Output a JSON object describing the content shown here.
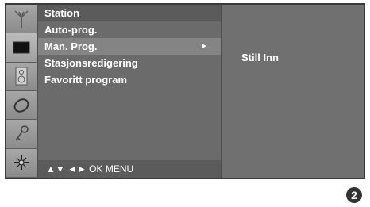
{
  "icons": [
    "antenna-icon",
    "picture-icon",
    "speaker-icon",
    "disc-icon",
    "key-icon",
    "settings-icon"
  ],
  "menu": {
    "title": "Station",
    "items": [
      {
        "label": "Auto-prog."
      },
      {
        "label": "Man. Prog.",
        "arrow": "►"
      },
      {
        "label": "Stasjonsredigering"
      },
      {
        "label": "Favoritt program"
      }
    ],
    "footer": "▲▼  ◄►  OK  MENU"
  },
  "submenu": {
    "text": "Still Inn"
  },
  "page_badge": "2",
  "colors": {
    "panel": "#6b6b6b",
    "selected": "#848484",
    "text": "#ffffff"
  }
}
